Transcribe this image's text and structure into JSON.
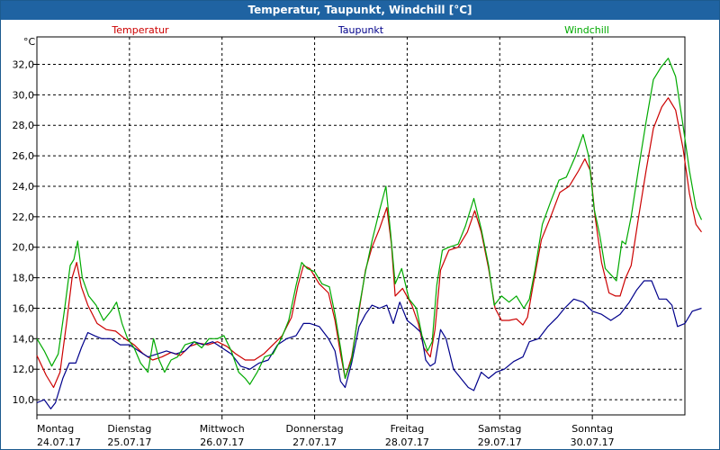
{
  "window": {
    "title": "Temperatur, Taupunkt, Windchill [°C]"
  },
  "chart_data": {
    "type": "line",
    "title": "Temperatur, Taupunkt, Windchill [°C]",
    "ylabel": "°C",
    "ylim": [
      9.0,
      33.8
    ],
    "yticks": [
      10,
      12,
      14,
      16,
      18,
      20,
      22,
      24,
      26,
      28,
      30,
      32
    ],
    "ytick_labels": [
      "10,0",
      "12,0",
      "14,0",
      "16,0",
      "18,0",
      "20,0",
      "22,0",
      "24,0",
      "26,0",
      "28,0",
      "30,0",
      "32,0"
    ],
    "xlim": [
      0,
      7
    ],
    "day_ticks": [
      {
        "day": "Montag",
        "date": "24.07.17"
      },
      {
        "day": "Dienstag",
        "date": "25.07.17"
      },
      {
        "day": "Mittwoch",
        "date": "26.07.17"
      },
      {
        "day": "Donnerstag",
        "date": "27.07.17"
      },
      {
        "day": "Freitag",
        "date": "28.07.17"
      },
      {
        "day": "Samstag",
        "date": "29.07.17"
      },
      {
        "day": "Sonntag",
        "date": "30.07.17"
      }
    ],
    "grid": true,
    "legend_position": "top",
    "series": [
      {
        "name": "Temperatur",
        "color": "#cc0000",
        "points": [
          [
            0.0,
            12.9
          ],
          [
            0.1,
            11.6
          ],
          [
            0.18,
            10.8
          ],
          [
            0.25,
            11.8
          ],
          [
            0.32,
            15.0
          ],
          [
            0.38,
            18.0
          ],
          [
            0.43,
            19.0
          ],
          [
            0.48,
            17.4
          ],
          [
            0.55,
            16.2
          ],
          [
            0.65,
            15.0
          ],
          [
            0.75,
            14.6
          ],
          [
            0.85,
            14.5
          ],
          [
            0.95,
            14.0
          ],
          [
            1.05,
            13.6
          ],
          [
            1.15,
            13.0
          ],
          [
            1.25,
            12.6
          ],
          [
            1.35,
            12.8
          ],
          [
            1.45,
            13.1
          ],
          [
            1.55,
            12.9
          ],
          [
            1.65,
            13.5
          ],
          [
            1.75,
            13.7
          ],
          [
            1.85,
            13.6
          ],
          [
            1.95,
            13.8
          ],
          [
            2.05,
            13.5
          ],
          [
            2.15,
            13.0
          ],
          [
            2.25,
            12.6
          ],
          [
            2.35,
            12.6
          ],
          [
            2.45,
            13.0
          ],
          [
            2.55,
            13.6
          ],
          [
            2.65,
            14.2
          ],
          [
            2.75,
            15.4
          ],
          [
            2.82,
            17.5
          ],
          [
            2.88,
            18.8
          ],
          [
            2.95,
            18.6
          ],
          [
            3.05,
            17.6
          ],
          [
            3.15,
            17.0
          ],
          [
            3.22,
            15.2
          ],
          [
            3.28,
            13.0
          ],
          [
            3.33,
            11.4
          ],
          [
            3.4,
            12.8
          ],
          [
            3.48,
            15.8
          ],
          [
            3.55,
            18.5
          ],
          [
            3.62,
            20.0
          ],
          [
            3.7,
            21.2
          ],
          [
            3.78,
            22.6
          ],
          [
            3.83,
            20.2
          ],
          [
            3.87,
            16.8
          ],
          [
            3.95,
            17.3
          ],
          [
            4.05,
            16.2
          ],
          [
            4.12,
            15.0
          ],
          [
            4.18,
            13.4
          ],
          [
            4.25,
            12.8
          ],
          [
            4.3,
            14.6
          ],
          [
            4.36,
            18.5
          ],
          [
            4.45,
            19.8
          ],
          [
            4.55,
            20.0
          ],
          [
            4.65,
            21.0
          ],
          [
            4.73,
            22.4
          ],
          [
            4.8,
            21.0
          ],
          [
            4.88,
            18.6
          ],
          [
            4.95,
            16.0
          ],
          [
            5.02,
            15.2
          ],
          [
            5.1,
            15.2
          ],
          [
            5.18,
            15.3
          ],
          [
            5.25,
            14.9
          ],
          [
            5.3,
            15.4
          ],
          [
            5.36,
            17.5
          ],
          [
            5.45,
            20.5
          ],
          [
            5.55,
            22.0
          ],
          [
            5.65,
            23.6
          ],
          [
            5.75,
            24.0
          ],
          [
            5.85,
            25.0
          ],
          [
            5.92,
            25.8
          ],
          [
            5.98,
            25.0
          ],
          [
            6.03,
            22.0
          ],
          [
            6.1,
            19.0
          ],
          [
            6.18,
            17.0
          ],
          [
            6.25,
            16.8
          ],
          [
            6.3,
            16.8
          ],
          [
            6.36,
            18.0
          ],
          [
            6.42,
            18.8
          ],
          [
            6.5,
            22.0
          ],
          [
            6.58,
            25.0
          ],
          [
            6.66,
            27.8
          ],
          [
            6.75,
            29.2
          ],
          [
            6.82,
            29.8
          ],
          [
            6.9,
            29.0
          ],
          [
            6.98,
            26.5
          ],
          [
            7.05,
            23.5
          ],
          [
            7.12,
            21.5
          ],
          [
            7.18,
            21.0
          ]
        ]
      },
      {
        "name": "Taupunkt",
        "color": "#00008b",
        "points": [
          [
            0.0,
            9.8
          ],
          [
            0.08,
            10.0
          ],
          [
            0.15,
            9.4
          ],
          [
            0.2,
            9.8
          ],
          [
            0.28,
            11.4
          ],
          [
            0.35,
            12.4
          ],
          [
            0.42,
            12.4
          ],
          [
            0.48,
            13.4
          ],
          [
            0.55,
            14.4
          ],
          [
            0.62,
            14.2
          ],
          [
            0.7,
            14.0
          ],
          [
            0.8,
            14.0
          ],
          [
            0.9,
            13.6
          ],
          [
            1.0,
            13.6
          ],
          [
            1.1,
            13.2
          ],
          [
            1.2,
            12.8
          ],
          [
            1.3,
            13.0
          ],
          [
            1.4,
            13.2
          ],
          [
            1.5,
            13.0
          ],
          [
            1.6,
            13.2
          ],
          [
            1.7,
            13.8
          ],
          [
            1.8,
            13.6
          ],
          [
            1.9,
            13.8
          ],
          [
            2.0,
            13.4
          ],
          [
            2.1,
            13.0
          ],
          [
            2.2,
            12.2
          ],
          [
            2.3,
            12.0
          ],
          [
            2.4,
            12.4
          ],
          [
            2.5,
            12.6
          ],
          [
            2.6,
            13.6
          ],
          [
            2.7,
            14.0
          ],
          [
            2.8,
            14.2
          ],
          [
            2.88,
            15.0
          ],
          [
            2.95,
            15.0
          ],
          [
            3.05,
            14.8
          ],
          [
            3.15,
            14.0
          ],
          [
            3.22,
            13.2
          ],
          [
            3.28,
            11.2
          ],
          [
            3.33,
            10.8
          ],
          [
            3.4,
            12.4
          ],
          [
            3.48,
            14.8
          ],
          [
            3.55,
            15.6
          ],
          [
            3.62,
            16.2
          ],
          [
            3.7,
            16.0
          ],
          [
            3.78,
            16.2
          ],
          [
            3.85,
            15.0
          ],
          [
            3.92,
            16.4
          ],
          [
            4.0,
            15.2
          ],
          [
            4.08,
            14.8
          ],
          [
            4.15,
            14.4
          ],
          [
            4.2,
            12.6
          ],
          [
            4.25,
            12.2
          ],
          [
            4.3,
            12.4
          ],
          [
            4.36,
            14.6
          ],
          [
            4.42,
            14.0
          ],
          [
            4.5,
            12.0
          ],
          [
            4.58,
            11.4
          ],
          [
            4.66,
            10.8
          ],
          [
            4.72,
            10.6
          ],
          [
            4.8,
            11.8
          ],
          [
            4.88,
            11.4
          ],
          [
            4.96,
            11.8
          ],
          [
            5.05,
            12.0
          ],
          [
            5.15,
            12.5
          ],
          [
            5.25,
            12.8
          ],
          [
            5.32,
            13.8
          ],
          [
            5.42,
            14.0
          ],
          [
            5.52,
            14.8
          ],
          [
            5.62,
            15.4
          ],
          [
            5.7,
            16.0
          ],
          [
            5.8,
            16.6
          ],
          [
            5.9,
            16.4
          ],
          [
            6.0,
            15.8
          ],
          [
            6.1,
            15.6
          ],
          [
            6.2,
            15.2
          ],
          [
            6.3,
            15.6
          ],
          [
            6.4,
            16.4
          ],
          [
            6.48,
            17.2
          ],
          [
            6.56,
            17.8
          ],
          [
            6.64,
            17.8
          ],
          [
            6.72,
            16.6
          ],
          [
            6.8,
            16.6
          ],
          [
            6.86,
            16.2
          ],
          [
            6.92,
            14.8
          ],
          [
            7.0,
            15.0
          ],
          [
            7.08,
            15.8
          ],
          [
            7.18,
            16.0
          ]
        ]
      },
      {
        "name": "Windchill",
        "color": "#00aa00",
        "points": [
          [
            0.0,
            14.0
          ],
          [
            0.08,
            13.2
          ],
          [
            0.16,
            12.2
          ],
          [
            0.23,
            13.0
          ],
          [
            0.3,
            16.0
          ],
          [
            0.36,
            18.8
          ],
          [
            0.4,
            19.2
          ],
          [
            0.44,
            20.4
          ],
          [
            0.49,
            18.0
          ],
          [
            0.56,
            16.8
          ],
          [
            0.64,
            16.2
          ],
          [
            0.72,
            15.2
          ],
          [
            0.8,
            15.8
          ],
          [
            0.86,
            16.4
          ],
          [
            0.92,
            15.0
          ],
          [
            0.98,
            14.0
          ],
          [
            1.05,
            13.4
          ],
          [
            1.12,
            12.4
          ],
          [
            1.2,
            11.8
          ],
          [
            1.26,
            14.0
          ],
          [
            1.32,
            12.6
          ],
          [
            1.38,
            11.8
          ],
          [
            1.45,
            12.6
          ],
          [
            1.52,
            12.8
          ],
          [
            1.6,
            13.6
          ],
          [
            1.7,
            13.8
          ],
          [
            1.78,
            13.4
          ],
          [
            1.86,
            14.0
          ],
          [
            1.95,
            14.0
          ],
          [
            2.02,
            14.2
          ],
          [
            2.1,
            13.2
          ],
          [
            2.18,
            11.8
          ],
          [
            2.25,
            11.4
          ],
          [
            2.3,
            11.0
          ],
          [
            2.38,
            11.8
          ],
          [
            2.46,
            12.8
          ],
          [
            2.55,
            13.0
          ],
          [
            2.64,
            14.0
          ],
          [
            2.72,
            15.2
          ],
          [
            2.8,
            17.5
          ],
          [
            2.86,
            19.0
          ],
          [
            2.92,
            18.6
          ],
          [
            3.0,
            18.4
          ],
          [
            3.08,
            17.6
          ],
          [
            3.16,
            17.4
          ],
          [
            3.22,
            15.6
          ],
          [
            3.28,
            13.4
          ],
          [
            3.33,
            11.4
          ],
          [
            3.4,
            12.6
          ],
          [
            3.48,
            16.0
          ],
          [
            3.55,
            18.4
          ],
          [
            3.62,
            20.4
          ],
          [
            3.7,
            22.4
          ],
          [
            3.77,
            24.0
          ],
          [
            3.82,
            21.0
          ],
          [
            3.87,
            17.6
          ],
          [
            3.94,
            18.6
          ],
          [
            4.02,
            16.6
          ],
          [
            4.1,
            16.0
          ],
          [
            4.16,
            14.2
          ],
          [
            4.22,
            13.2
          ],
          [
            4.27,
            13.8
          ],
          [
            4.32,
            17.5
          ],
          [
            4.38,
            19.8
          ],
          [
            4.45,
            20.0
          ],
          [
            4.55,
            20.2
          ],
          [
            4.63,
            21.4
          ],
          [
            4.72,
            23.2
          ],
          [
            4.8,
            21.2
          ],
          [
            4.88,
            18.8
          ],
          [
            4.94,
            16.2
          ],
          [
            5.02,
            16.8
          ],
          [
            5.1,
            16.4
          ],
          [
            5.18,
            16.8
          ],
          [
            5.26,
            16.0
          ],
          [
            5.32,
            16.6
          ],
          [
            5.38,
            18.5
          ],
          [
            5.46,
            21.5
          ],
          [
            5.55,
            23.0
          ],
          [
            5.64,
            24.4
          ],
          [
            5.72,
            24.6
          ],
          [
            5.82,
            26.0
          ],
          [
            5.9,
            27.4
          ],
          [
            5.96,
            26.0
          ],
          [
            6.02,
            22.5
          ],
          [
            6.08,
            20.8
          ],
          [
            6.14,
            18.6
          ],
          [
            6.2,
            18.2
          ],
          [
            6.26,
            17.8
          ],
          [
            6.32,
            20.4
          ],
          [
            6.36,
            20.2
          ],
          [
            6.42,
            22.0
          ],
          [
            6.5,
            25.2
          ],
          [
            6.58,
            28.2
          ],
          [
            6.66,
            31.0
          ],
          [
            6.74,
            31.8
          ],
          [
            6.82,
            32.4
          ],
          [
            6.9,
            31.2
          ],
          [
            6.98,
            28.0
          ],
          [
            7.05,
            25.0
          ],
          [
            7.12,
            22.6
          ],
          [
            7.18,
            21.8
          ]
        ]
      }
    ]
  }
}
